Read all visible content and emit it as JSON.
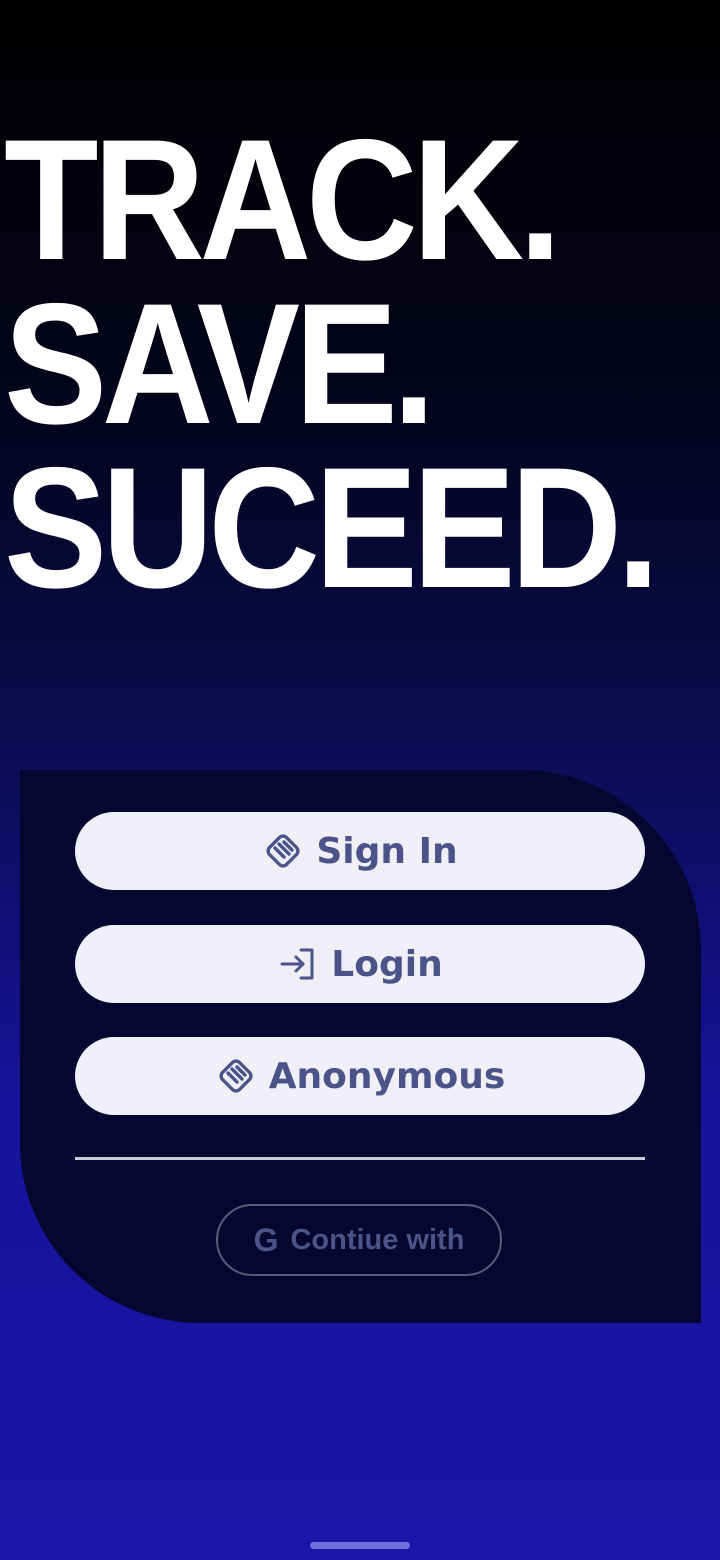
{
  "hero": {
    "lines": [
      "TRACK.",
      "SAVE.",
      "SUCEED."
    ]
  },
  "auth": {
    "sign_in": {
      "label": "Sign In",
      "icon": "handshake-icon"
    },
    "login": {
      "label": "Login",
      "icon": "login-arrow-icon"
    },
    "anonymous": {
      "label": "Anonymous",
      "icon": "handshake-icon"
    },
    "google": {
      "label": "Contiue with",
      "icon_glyph": "G",
      "icon": "google-icon"
    }
  },
  "colors": {
    "button_bg": "#f0eff8",
    "button_text": "#4a5488",
    "panel_bg": "#070630",
    "gradient_bottom": "#1a16aa"
  }
}
